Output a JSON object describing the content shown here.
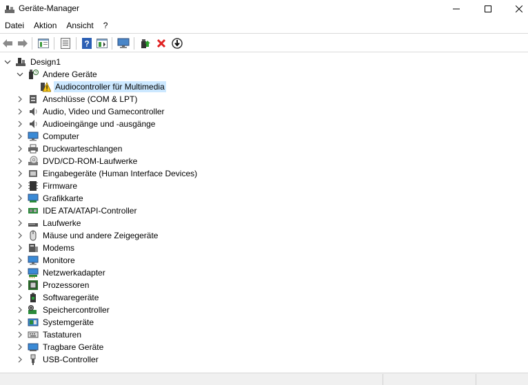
{
  "window": {
    "title": "Geräte-Manager"
  },
  "menu": [
    "Datei",
    "Aktion",
    "Ansicht",
    "?"
  ],
  "toolbar": {
    "buttons": [
      "back-arrow-icon",
      "forward-arrow-icon",
      "tree-view-icon",
      "properties-icon",
      "help-icon",
      "details-icon",
      "monitor-scan-icon",
      "update-driver-icon",
      "uninstall-icon",
      "disable-icon"
    ]
  },
  "tree": {
    "root": "Design1",
    "other_devices": "Andere Geräte",
    "selected_device": "Audiocontroller für Multimedia",
    "categories": [
      "Anschlüsse (COM & LPT)",
      "Audio, Video und Gamecontroller",
      "Audioeingänge und -ausgänge",
      "Computer",
      "Druckwarteschlangen",
      "DVD/CD-ROM-Laufwerke",
      "Eingabegeräte (Human Interface Devices)",
      "Firmware",
      "Grafikkarte",
      "IDE ATA/ATAPI-Controller",
      "Laufwerke",
      "Mäuse und andere Zeigegeräte",
      "Modems",
      "Monitore",
      "Netzwerkadapter",
      "Prozessoren",
      "Softwaregeräte",
      "Speichercontroller",
      "Systemgeräte",
      "Tastaturen",
      "Tragbare Geräte",
      "USB-Controller"
    ]
  }
}
